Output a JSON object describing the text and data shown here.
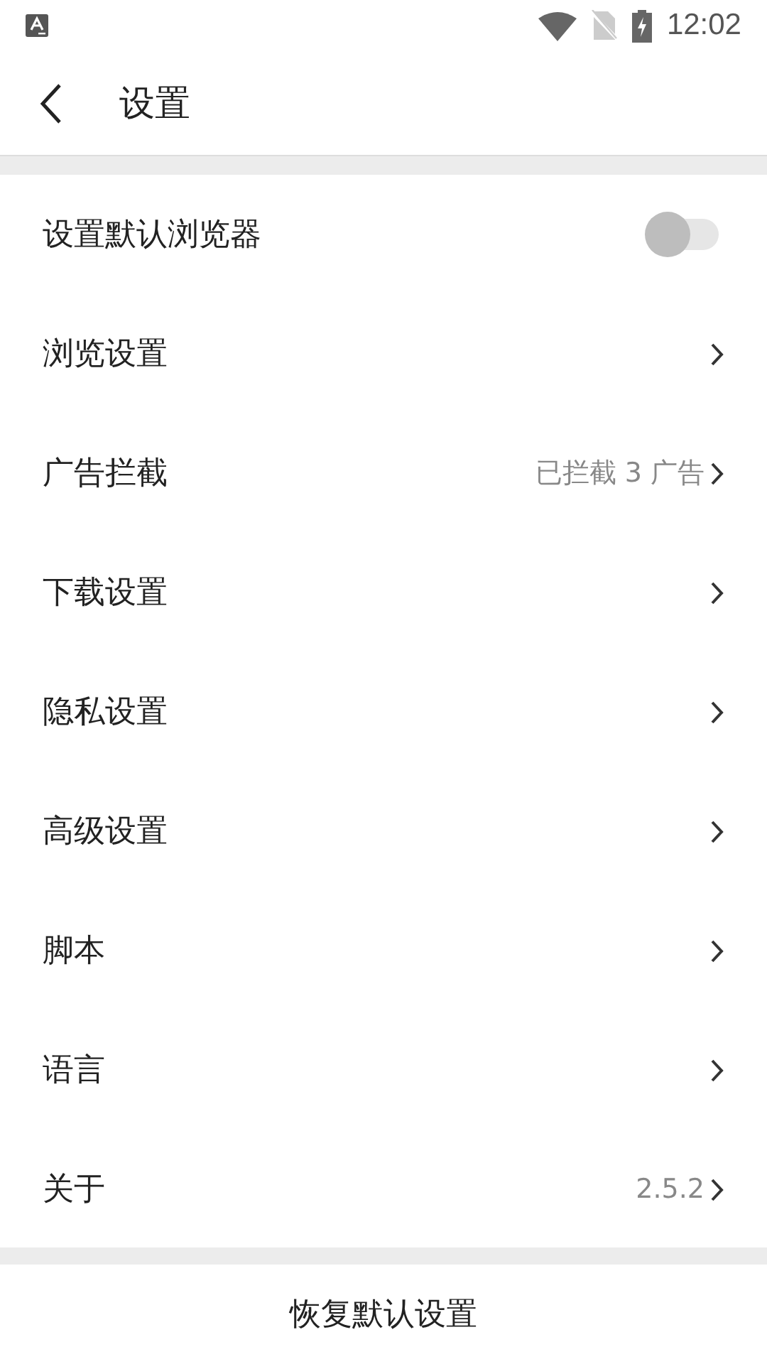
{
  "status_bar": {
    "time": "12:02"
  },
  "header": {
    "title": "设置"
  },
  "settings": [
    {
      "kind": "toggle",
      "label": "设置默认浏览器",
      "on": false
    },
    {
      "kind": "link",
      "label": "浏览设置"
    },
    {
      "kind": "link",
      "label": "广告拦截",
      "value": "已拦截 3 广告"
    },
    {
      "kind": "link",
      "label": "下载设置"
    },
    {
      "kind": "link",
      "label": "隐私设置"
    },
    {
      "kind": "link",
      "label": "高级设置"
    },
    {
      "kind": "link",
      "label": "脚本"
    },
    {
      "kind": "link",
      "label": "语言"
    },
    {
      "kind": "link",
      "label": "关于",
      "value": "2.5.2"
    }
  ],
  "reset_button": "恢复默认设置"
}
